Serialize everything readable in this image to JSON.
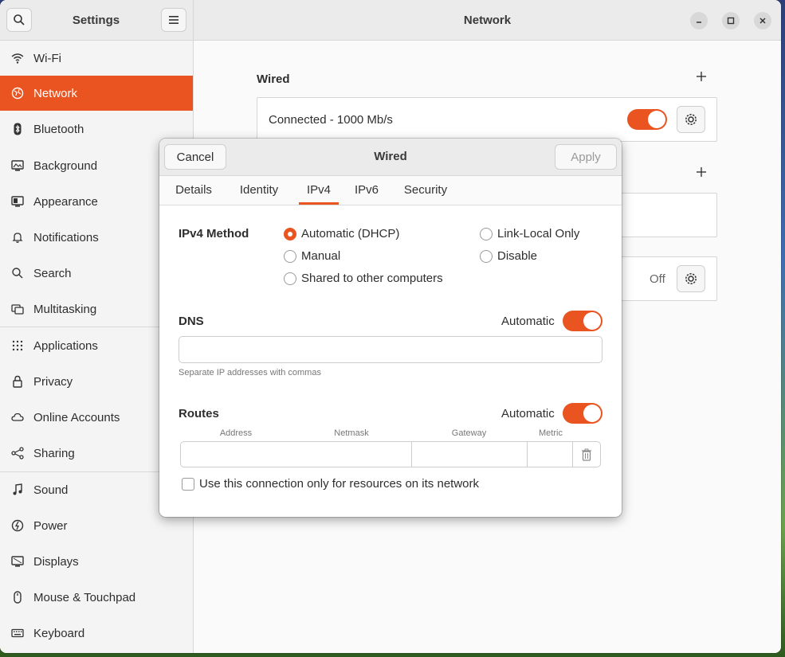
{
  "header": {
    "sidebar_title": "Settings",
    "page_title": "Network"
  },
  "sidebar": {
    "items": [
      {
        "label": "Wi-Fi",
        "icon": "wifi-icon"
      },
      {
        "label": "Network",
        "icon": "network-icon",
        "active": true
      },
      {
        "label": "Bluetooth",
        "icon": "bluetooth-icon"
      },
      {
        "label": "Background",
        "icon": "background-icon"
      },
      {
        "label": "Appearance",
        "icon": "appearance-icon"
      },
      {
        "label": "Notifications",
        "icon": "bell-icon"
      },
      {
        "label": "Search",
        "icon": "search-icon"
      },
      {
        "label": "Multitasking",
        "icon": "multitasking-icon"
      },
      {
        "label": "Applications",
        "icon": "grid-icon"
      },
      {
        "label": "Privacy",
        "icon": "lock-icon"
      },
      {
        "label": "Online Accounts",
        "icon": "cloud-icon"
      },
      {
        "label": "Sharing",
        "icon": "share-icon"
      },
      {
        "label": "Sound",
        "icon": "music-note-icon"
      },
      {
        "label": "Power",
        "icon": "power-icon"
      },
      {
        "label": "Displays",
        "icon": "display-icon"
      },
      {
        "label": "Mouse & Touchpad",
        "icon": "mouse-icon"
      },
      {
        "label": "Keyboard",
        "icon": "keyboard-icon"
      }
    ]
  },
  "main": {
    "wired_title": "Wired",
    "wired_status": "Connected - 1000 Mb/s",
    "wired_switch_on": true,
    "proxy_status": "Off"
  },
  "dialog": {
    "title": "Wired",
    "cancel_label": "Cancel",
    "apply_label": "Apply",
    "tabs": [
      "Details",
      "Identity",
      "IPv4",
      "IPv6",
      "Security"
    ],
    "active_tab": "IPv4",
    "ipv4_method_label": "IPv4 Method",
    "methods": {
      "automatic_dhcp": "Automatic (DHCP)",
      "manual": "Manual",
      "shared": "Shared to other computers",
      "link_local": "Link-Local Only",
      "disable": "Disable"
    },
    "selected_method": "Automatic (DHCP)",
    "dns_label": "DNS",
    "dns_automatic_label": "Automatic",
    "dns_value": "",
    "dns_hint": "Separate IP addresses with commas",
    "routes_label": "Routes",
    "routes_automatic_label": "Automatic",
    "route_columns": [
      "Address",
      "Netmask",
      "Gateway",
      "Metric"
    ],
    "only_resources_label": "Use this connection only for resources on its network"
  },
  "colors": {
    "accent": "#e95420",
    "sidebar_bg": "#f4f4f4",
    "header_bg": "#ebebeb"
  }
}
